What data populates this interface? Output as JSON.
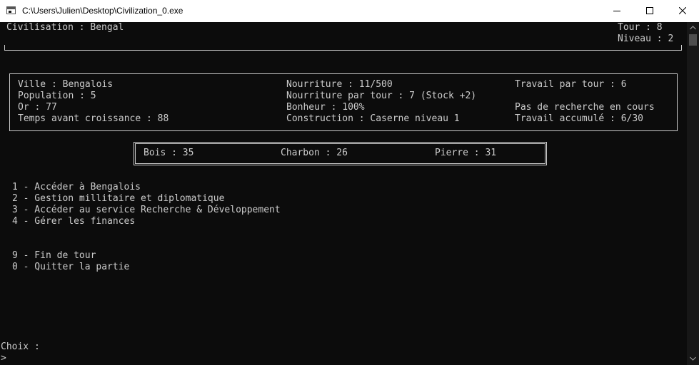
{
  "window": {
    "title": "C:\\Users\\Julien\\Desktop\\Civilization_0.exe",
    "icons": {
      "app": "console-app-icon",
      "minimize": "minimize-icon",
      "maximize": "maximize-icon",
      "close": "close-icon"
    }
  },
  "header": {
    "civilisation": "Civilisation : Bengal",
    "tour": "Tour : 8",
    "niveau": "Niveau : 2"
  },
  "city_panel": {
    "ville": "Ville : Bengalois",
    "population": "Population : 5",
    "or": "Or : 77",
    "croissance": "Temps avant croissance : 88",
    "nourriture": "Nourriture : 11/500",
    "nourriture_par_tour": "Nourriture par tour : 7 (Stock +2)",
    "bonheur": "Bonheur : 100%",
    "construction": "Construction : Caserne niveau 1",
    "travail_par_tour": "Travail par tour : 6",
    "recherche": "Pas de recherche en cours",
    "travail_accumule": "Travail accumulé : 6/30"
  },
  "resources": {
    "bois": "Bois : 35",
    "charbon": "Charbon : 26",
    "pierre": "Pierre : 31"
  },
  "menu": {
    "items": [
      "1 - Accéder à Bengalois",
      "2 - Gestion millitaire et diplomatique",
      "3 - Accéder au service Recherche & Développement",
      "4 - Gérer les finances"
    ],
    "end_items": [
      "9 - Fin de tour",
      "0 - Quitter la partie"
    ]
  },
  "prompt": {
    "label": "Choix :",
    "cursor": ">"
  },
  "colors": {
    "background": "#0c0c0c",
    "text": "#cccccc",
    "titlebar": "#ffffff"
  }
}
